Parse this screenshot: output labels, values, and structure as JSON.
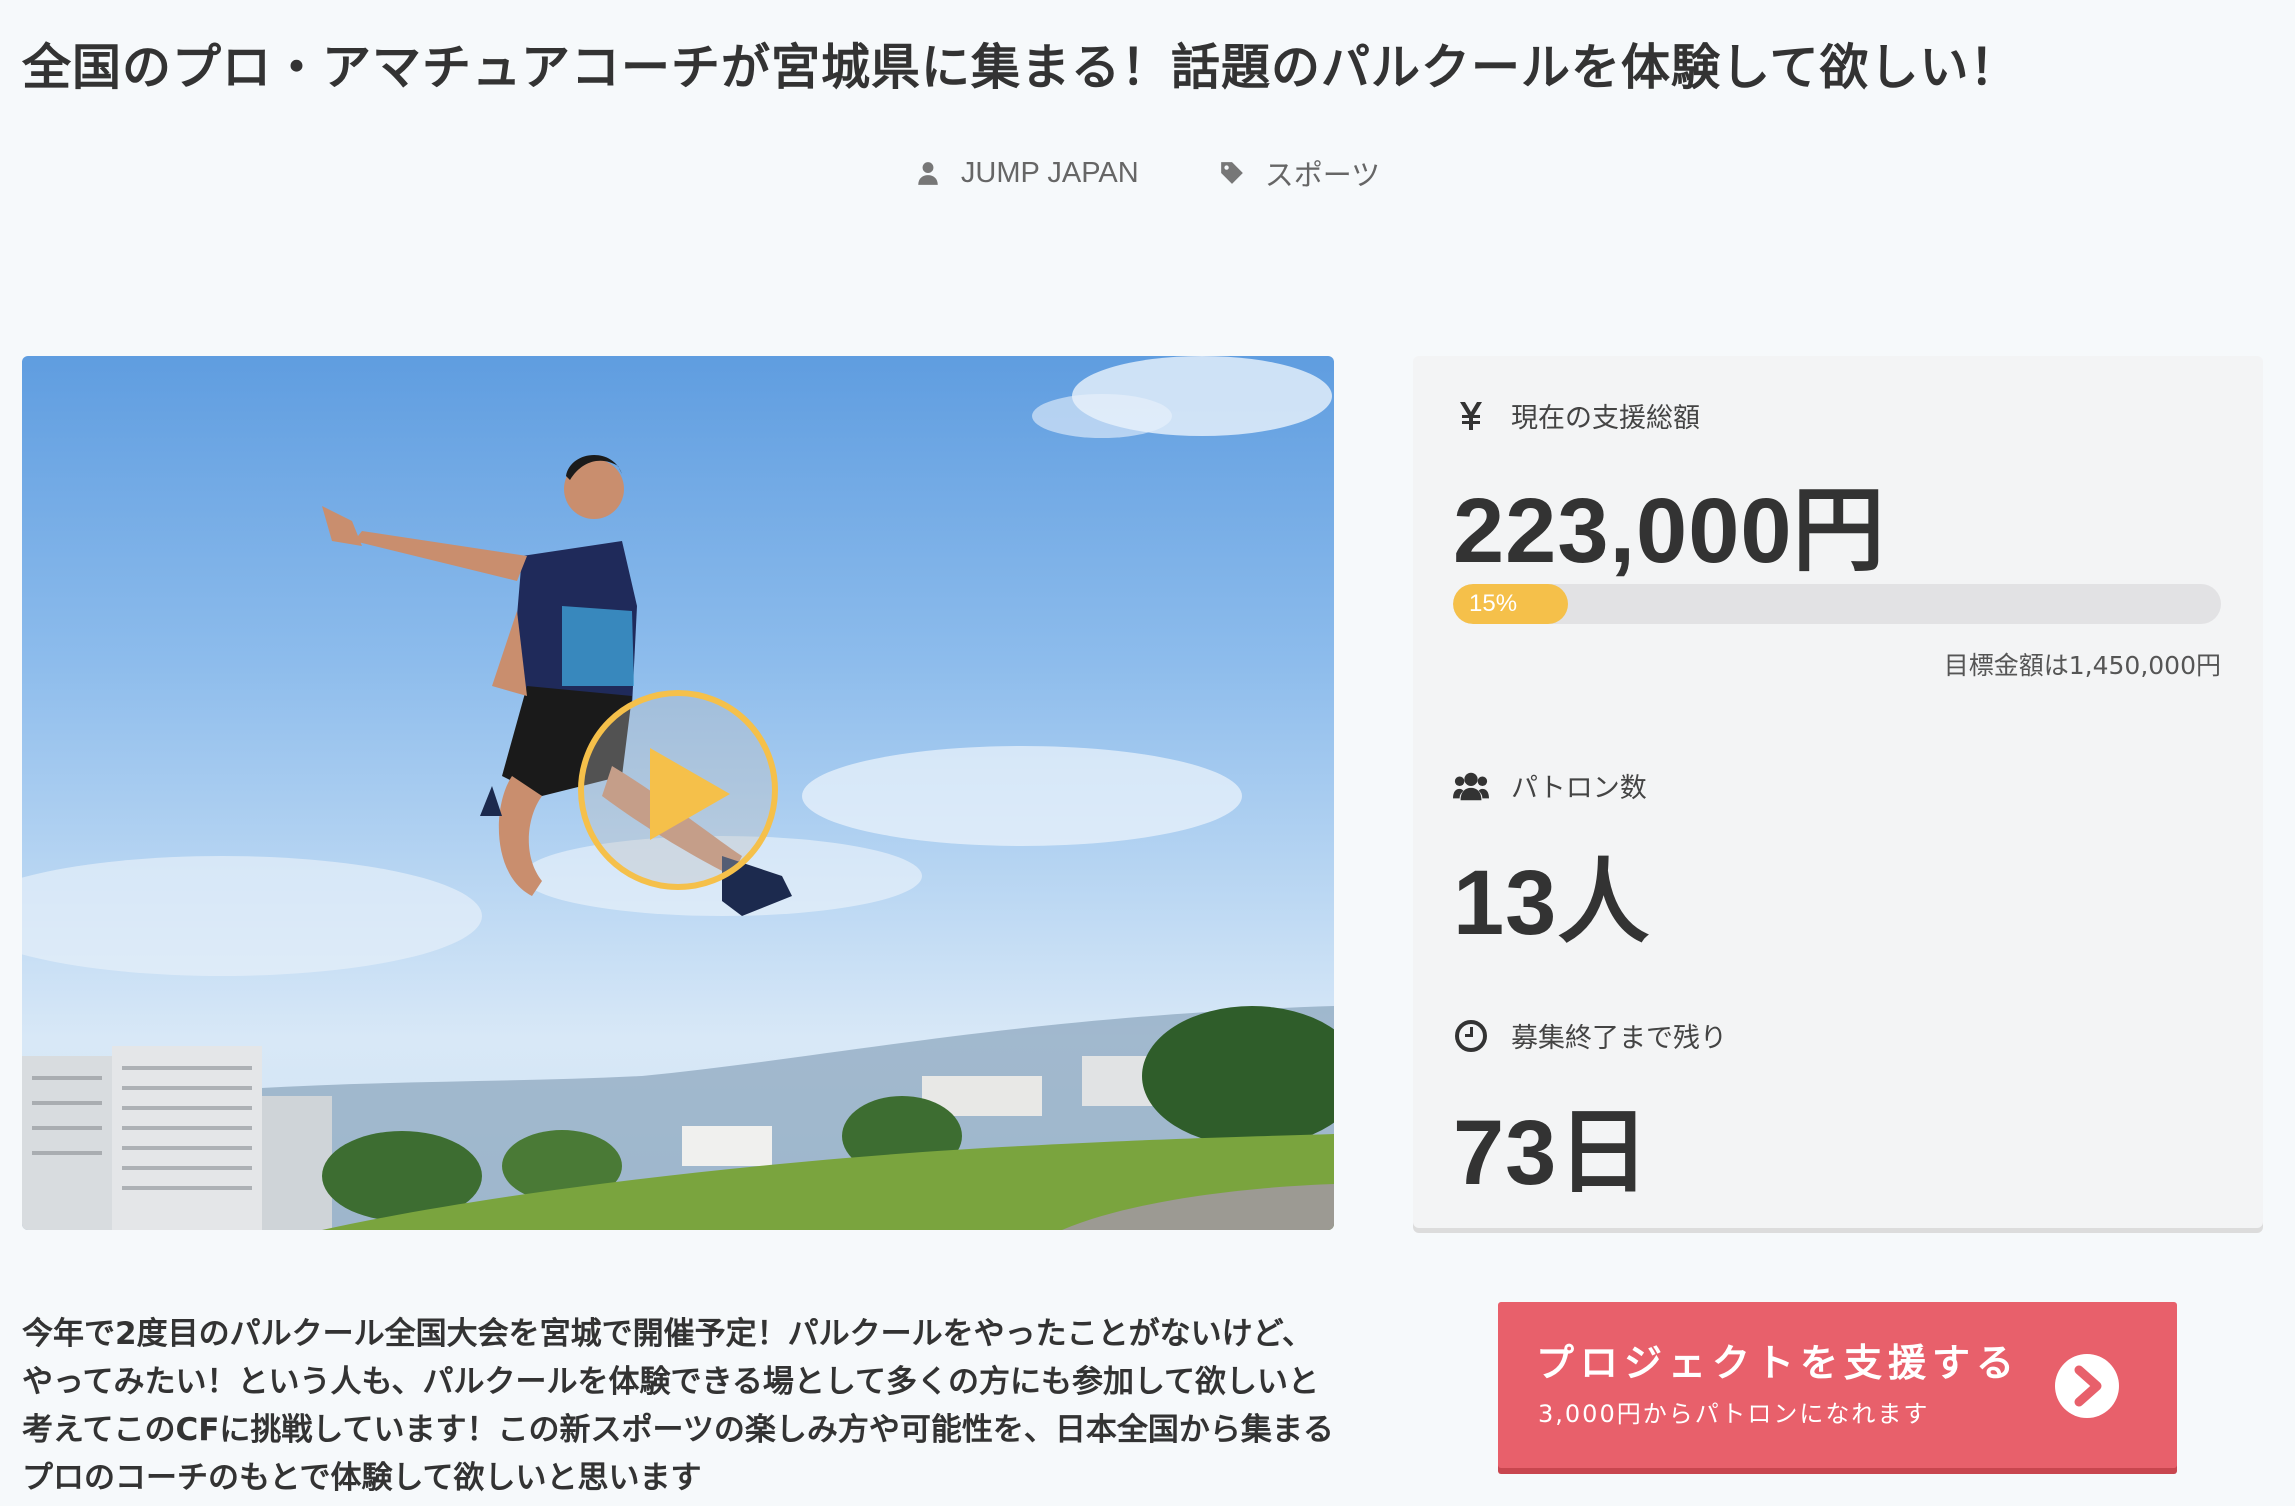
{
  "header": {
    "title": "全国のプロ・アマチュアコーチが宮城県に集まる！話題のパルクールを体験して欲しい！",
    "owner": "JUMP JAPAN",
    "category": "スポーツ"
  },
  "video": {
    "play_icon": "play-icon",
    "accent": "#f5c04a"
  },
  "stats": {
    "amount_label": "現在の支援総額",
    "amount_value": "223,000円",
    "progress_percent": 15,
    "progress_label": "15%",
    "goal_text": "目標金額は1,450,000円",
    "patrons_label": "パトロン数",
    "patrons_value": "13人",
    "remaining_label": "募集終了まで残り",
    "remaining_value": "73日"
  },
  "description": "今年で2度目のパルクール全国大会を宮城で開催予定！パルクールをやったことがないけど、やってみたい！という人も、パルクールを体験できる場として多くの方にも参加して欲しいと考えてこのCFに挑戦しています！この新スポーツの楽しみ方や可能性を、日本全国から集まるプロのコーチのもとで体験して欲しいと思います",
  "cta": {
    "label": "プロジェクトを支援する",
    "sub": "3,000円からパトロンになれます",
    "color": "#e8606b"
  }
}
